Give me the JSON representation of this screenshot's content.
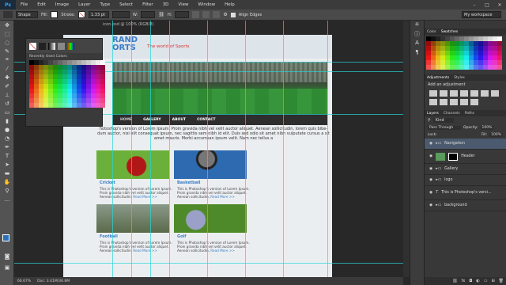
{
  "app": {
    "logo": "Ps"
  },
  "menu": [
    "File",
    "Edit",
    "Image",
    "Layer",
    "Type",
    "Select",
    "Filter",
    "3D",
    "View",
    "Window",
    "Help"
  ],
  "window_buttons": [
    "–",
    "□",
    "✕"
  ],
  "options": {
    "shape": "Shape",
    "fill": "Fill:",
    "stroke": "Stroke:",
    "stroke_width": "1.33 pt",
    "w": "W:",
    "h": "H:",
    "align_edges": "Align Edges"
  },
  "workspace": "My workspace",
  "swatch_popup": {
    "title": "Recently Used Colors"
  },
  "document": {
    "brand": "RAND\nORTS",
    "tagline": "The world of Sports",
    "tab": "icon.psd @ 100% (RGB/8)",
    "nav": [
      "HOME",
      "GALLERY",
      "ABOUT",
      "CONTACT"
    ],
    "nav_visible": [
      "GALLERY",
      "ABOUT",
      "CONTACT"
    ],
    "intro": "hotoshop's version of Lorem Ipsum. Proin gravida nibh vel velit auctor aliquet. Aenean sollicitudin, lorem quis bibe- dum auctor, nisi elit consequat ipsum, nec sagittis sem nibh id elit. Duis sed odio sit amet nibh vulputate cursus a sit amet mauris. Morbi accumsan ipsum velit. Nam nec tellus a",
    "cards": [
      {
        "title": "Cricket",
        "text": "This is Photoshop's version of Lorem Ipsum. Proin gravida nibh vel velit auctor aliquet. Aenean sollicitudin,",
        "more": "Read More >>"
      },
      {
        "title": "Basketball",
        "text": "This is Photoshop's version of Lorem Ipsum. Proin gravida nibh vel velit auctor aliquet. Aenean sollicitudin,",
        "more": "Read More >>"
      },
      {
        "title": "Football",
        "text": "This is Photoshop's version of Lorem Ipsum. Proin gravida nibh vel velit auctor aliquet. Aenean sollicitudin,",
        "more": "Read More >>"
      },
      {
        "title": "Golf",
        "text": "This is Photoshop's version of Lorem Ipsum. Proin gravida nibh vel velit auctor aliquet. Aenean sollicitudin,",
        "more": "Read More >>"
      }
    ]
  },
  "status": {
    "zoom": "66.67%",
    "doc": "Doc: 3.41M/36.8M"
  },
  "panels": {
    "color_tabs": [
      "Color",
      "Swatches"
    ],
    "adj_tabs": [
      "Adjustments",
      "Styles"
    ],
    "adj_title": "Add an adjustment",
    "layer_tabs": [
      "Layers",
      "Channels",
      "Paths"
    ],
    "kind": "Kind",
    "blend": "Pass Through",
    "opacity_label": "Opacity:",
    "opacity": "100%",
    "lock": "Lock:",
    "fill_label": "Fill:",
    "fill": "100%",
    "layers": [
      "Navigation",
      "Header",
      "Gallery",
      "logo",
      "This is Photoshop's versi...",
      "background"
    ]
  },
  "colors": {
    "accent": "#3a7cc6",
    "tagline": "#dd3333",
    "guide": "#28d6d6",
    "selected_layer": "#4b5a6e"
  }
}
